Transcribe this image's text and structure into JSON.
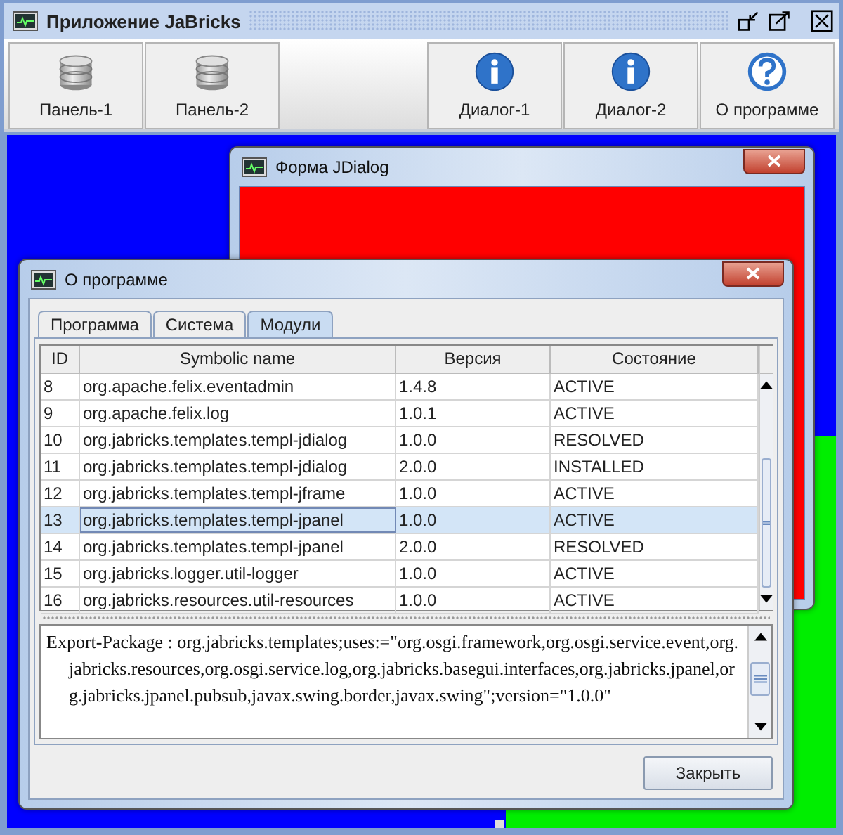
{
  "window": {
    "title": "Приложение JaBricks"
  },
  "toolbar": [
    {
      "label": "Панель-1",
      "kind": "database"
    },
    {
      "label": "Панель-2",
      "kind": "database"
    },
    {
      "kind": "spacer"
    },
    {
      "label": "Диалог-1",
      "kind": "info"
    },
    {
      "label": "Диалог-2",
      "kind": "info"
    },
    {
      "label": "О программе",
      "kind": "help"
    }
  ],
  "back_dialog": {
    "title": "Форма JDialog"
  },
  "about_dialog": {
    "title": "О программе",
    "tabs": [
      {
        "label": "Программа",
        "selected": false
      },
      {
        "label": "Система",
        "selected": false
      },
      {
        "label": "Модули",
        "selected": true
      }
    ],
    "table": {
      "columns": [
        "ID",
        "Symbolic name",
        "Версия",
        "Состояние"
      ],
      "rows": [
        {
          "cells": [
            "8",
            "org.apache.felix.eventadmin",
            "1.4.8",
            "ACTIVE"
          ],
          "selected": false
        },
        {
          "cells": [
            "9",
            "org.apache.felix.log",
            "1.0.1",
            "ACTIVE"
          ],
          "selected": false
        },
        {
          "cells": [
            "10",
            "org.jabricks.templates.templ-jdialog",
            "1.0.0",
            "RESOLVED"
          ],
          "selected": false
        },
        {
          "cells": [
            "11",
            "org.jabricks.templates.templ-jdialog",
            "2.0.0",
            "INSTALLED"
          ],
          "selected": false
        },
        {
          "cells": [
            "12",
            "org.jabricks.templates.templ-jframe",
            "1.0.0",
            "ACTIVE"
          ],
          "selected": false
        },
        {
          "cells": [
            "13",
            "org.jabricks.templates.templ-jpanel",
            "1.0.0",
            "ACTIVE"
          ],
          "selected": true
        },
        {
          "cells": [
            "14",
            "org.jabricks.templates.templ-jpanel",
            "2.0.0",
            "RESOLVED"
          ],
          "selected": false
        },
        {
          "cells": [
            "15",
            "org.jabricks.logger.util-logger",
            "1.0.0",
            "ACTIVE"
          ],
          "selected": false
        },
        {
          "cells": [
            "16",
            "org.jabricks.resources.util-resources",
            "1.0.0",
            "ACTIVE"
          ],
          "selected": false
        }
      ]
    },
    "details": "Export-Package : org.jabricks.templates;uses:=\"org.osgi.framework,org.osgi.service.event,org.jabricks.resources,org.osgi.service.log,org.jabricks.basegui.interfaces,org.jabricks.jpanel,org.jabricks.jpanel.pubsub,javax.swing.border,javax.swing\";version=\"1.0.0\"",
    "close_button": "Закрыть"
  }
}
